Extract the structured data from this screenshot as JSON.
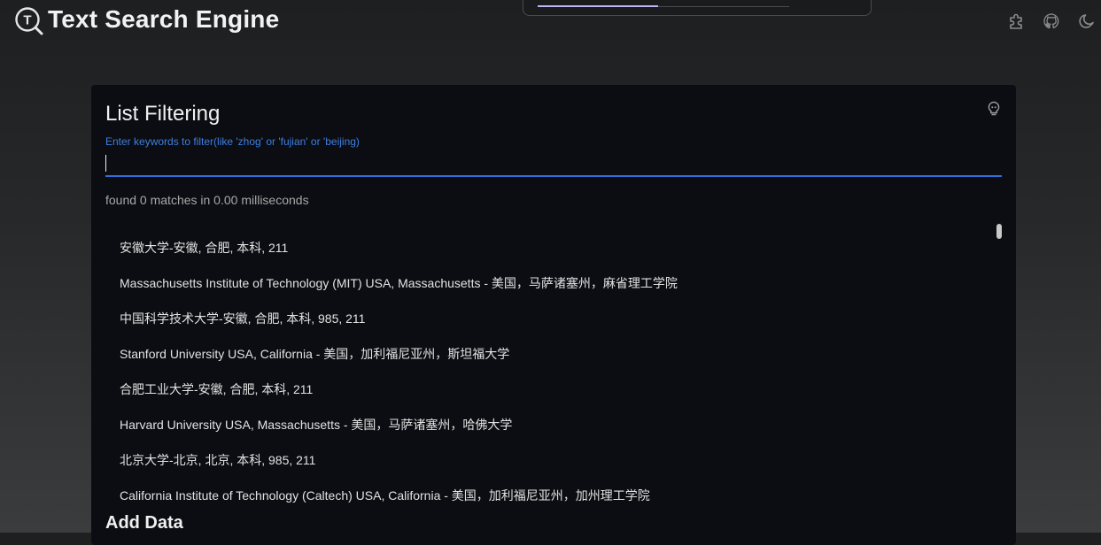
{
  "header": {
    "app_title": "Text Search Engine",
    "logo_letter": "T",
    "progress_fraction": 0.48,
    "icons": [
      "puzzle-icon",
      "github-icon",
      "moon-icon"
    ]
  },
  "card": {
    "title": "List Filtering",
    "hint_icon": "bulb-icon",
    "input": {
      "label": "Enter keywords to filter(like 'zhog' or 'fujian' or 'beijing)",
      "value": ""
    },
    "match_info": "found 0 matches in 0.00 milliseconds",
    "items": [
      "安徽大学-安徽, 合肥, 本科, 211",
      "Massachusetts Institute of Technology (MIT) USA, Massachusetts - 美国，马萨诸塞州，麻省理工学院",
      "中国科学技术大学-安徽, 合肥, 本科, 985, 211",
      "Stanford University USA, California - 美国，加利福尼亚州，斯坦福大学",
      "合肥工业大学-安徽, 合肥, 本科, 211",
      "Harvard University USA, Massachusetts - 美国，马萨诸塞州，哈佛大学",
      "北京大学-北京, 北京, 本科, 985, 211",
      "California Institute of Technology (Caltech) USA, California - 美国，加利福尼亚州，加州理工学院"
    ],
    "add_data_title": "Add Data"
  },
  "colors": {
    "accent": "#2f6fd6",
    "progress": "#b9b4f2",
    "card_bg": "#0b0d12"
  }
}
